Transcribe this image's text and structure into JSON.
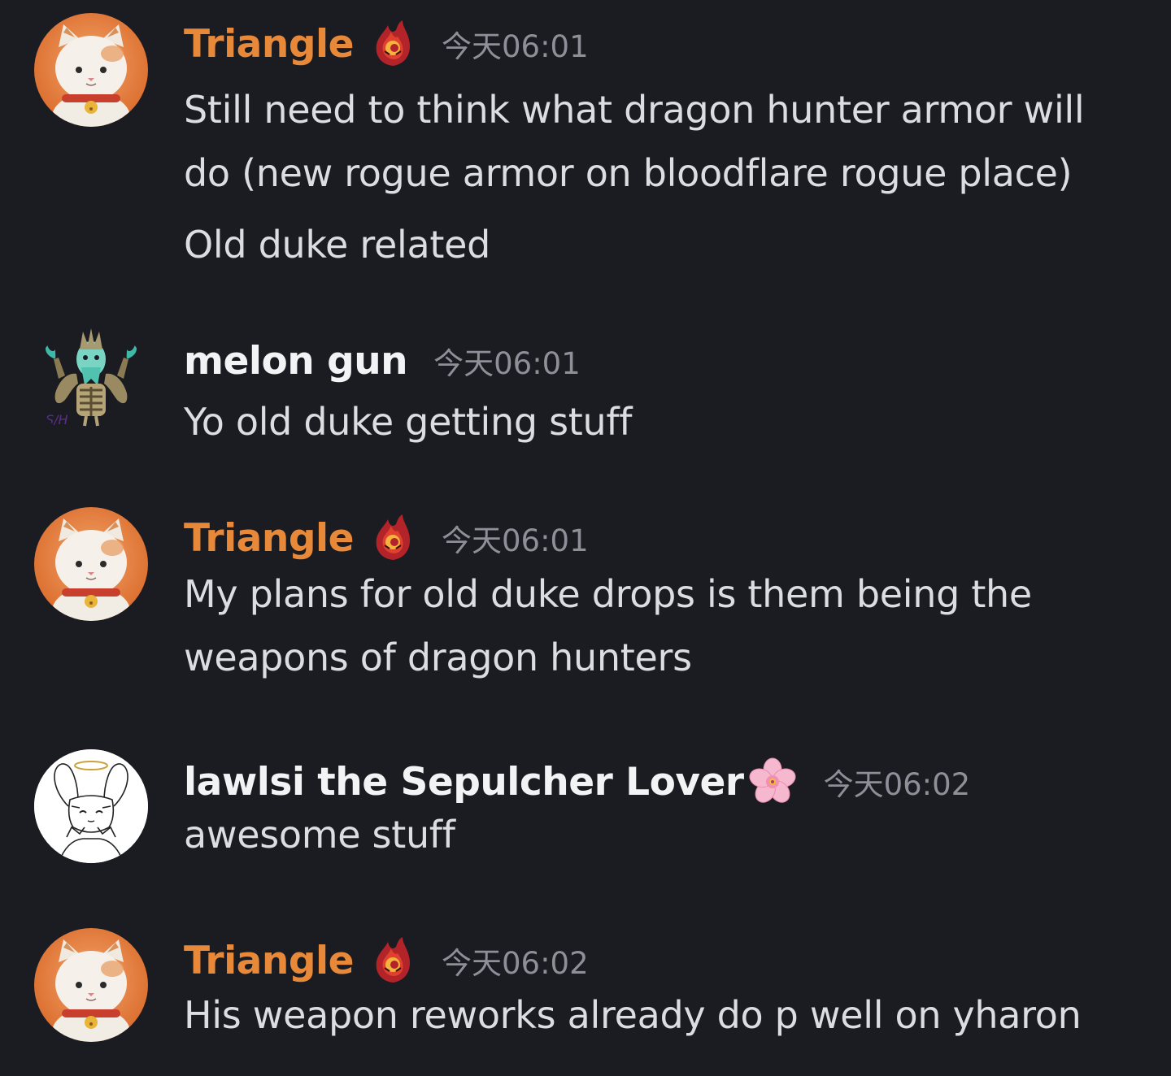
{
  "colors": {
    "background": "#1b1c21",
    "triangle_name": "#e8893a",
    "default_name": "#f2f3f5",
    "timestamp": "#8d9099",
    "message_text": "#dcdde1"
  },
  "messages": [
    {
      "username": "Triangle",
      "avatar_icon": "cat-avatar",
      "badge_icon": "flame-role-icon",
      "timestamp": "今天06:01",
      "lines": [
        "Still need to think what dragon hunter armor will",
        "do (new rogue armor on bloodflare rogue place)"
      ],
      "extra_lines": [
        "Old duke related"
      ]
    },
    {
      "username": "melon gun",
      "avatar_icon": "monster-avatar",
      "timestamp": "今天06:01",
      "lines": [
        "Yo old duke getting stuff"
      ]
    },
    {
      "username": "Triangle",
      "avatar_icon": "cat-avatar",
      "badge_icon": "flame-role-icon",
      "timestamp": "今天06:01",
      "lines": [
        "My plans for old duke drops is them being the",
        "weapons of dragon hunters"
      ]
    },
    {
      "username": "lawlsi the Sepulcher Lover",
      "avatar_icon": "bunny-sketch-avatar",
      "badge_icon": "cherry-blossom-icon",
      "timestamp": "今天06:02",
      "lines": [
        "awesome stuff"
      ]
    },
    {
      "username": "Triangle",
      "avatar_icon": "cat-avatar",
      "badge_icon": "flame-role-icon",
      "timestamp": "今天06:02",
      "lines": [
        "His weapon reworks already do p well on yharon"
      ]
    }
  ]
}
